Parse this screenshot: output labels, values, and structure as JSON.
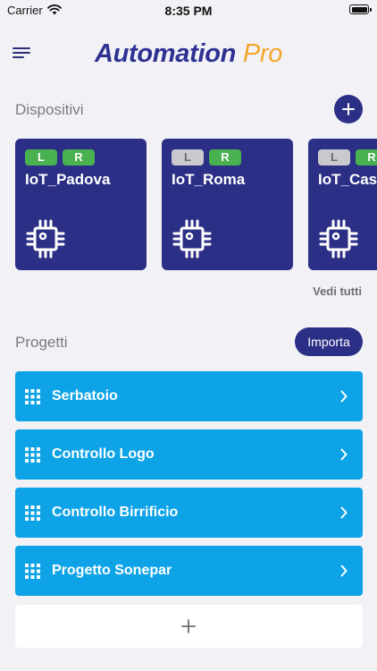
{
  "status_bar": {
    "carrier": "Carrier",
    "time": "8:35 PM"
  },
  "header": {
    "title_part1": "Automation",
    "title_part2": "Pro"
  },
  "devices_section": {
    "title": "Dispositivi",
    "see_all": "Vedi tutti",
    "devices": [
      {
        "name": "IoT_Padova",
        "tag_l": "L",
        "tag_r": "R",
        "l_active": true,
        "r_active": true
      },
      {
        "name": "IoT_Roma",
        "tag_l": "L",
        "tag_r": "R",
        "l_active": false,
        "r_active": true
      },
      {
        "name": "IoT_Casei",
        "tag_l": "L",
        "tag_r": "R",
        "l_active": false,
        "r_active": true
      }
    ]
  },
  "projects_section": {
    "title": "Progetti",
    "import_label": "Importa",
    "projects": [
      {
        "label": "Serbatoio"
      },
      {
        "label": "Controllo Logo"
      },
      {
        "label": "Controllo Birrificio"
      },
      {
        "label": "Progetto Sonepar"
      }
    ]
  },
  "colors": {
    "navy": "#2c2f86",
    "title_blue": "#2e3192",
    "title_orange": "#f4a62a",
    "project_blue": "#0ea3e6",
    "tag_green": "#49b150",
    "tag_gray": "#c9c9ce",
    "background": "#f2f2f6"
  },
  "icons": [
    "wifi-icon",
    "battery-icon",
    "menu-icon",
    "plus-icon",
    "chip-icon",
    "grid-icon",
    "chevron-right-icon"
  ]
}
